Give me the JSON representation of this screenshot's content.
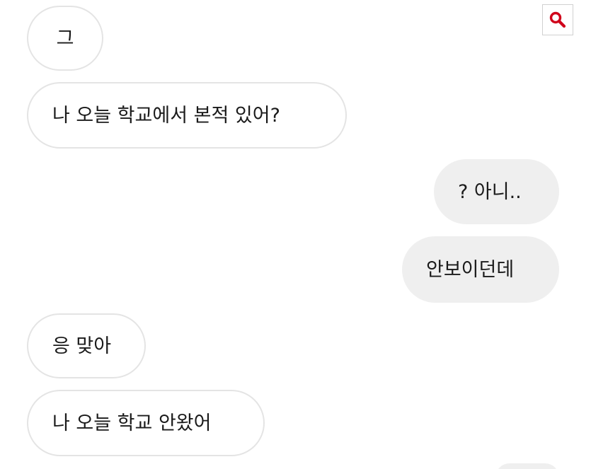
{
  "toolbar": {
    "search_icon": "search-icon",
    "search_icon_color": "#d0021b"
  },
  "messages": [
    {
      "side": "incoming",
      "text": "그"
    },
    {
      "side": "incoming",
      "text": "나 오늘 학교에서 본적 있어?"
    },
    {
      "side": "outgoing",
      "text": "? 아니.."
    },
    {
      "side": "outgoing",
      "text": "안보이던데"
    },
    {
      "side": "incoming",
      "text": "응 맞아"
    },
    {
      "side": "incoming",
      "text": "나 오늘 학교 안왔어"
    }
  ],
  "colors": {
    "outgoing_bubble": "#efefef",
    "incoming_border": "#e4e4e4"
  }
}
